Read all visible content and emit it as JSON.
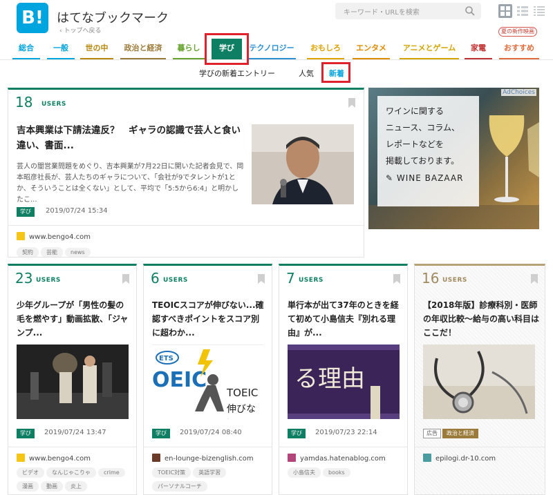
{
  "header": {
    "logo": "B!",
    "title": "はてなブックマーク",
    "back": "トップへ戻る",
    "search_placeholder": "キーワード・URLを検索",
    "promo_pill": "夏の新作映画"
  },
  "categories": [
    {
      "label": "総合",
      "color": "#00a4de"
    },
    {
      "label": "一般",
      "color": "#00a4de"
    },
    {
      "label": "世の中",
      "color": "#b8860b"
    },
    {
      "label": "政治と経済",
      "color": "#9b7b3a"
    },
    {
      "label": "暮らし",
      "color": "#65a32d"
    },
    {
      "label": "学び",
      "color": "#0e7f62"
    },
    {
      "label": "テクノロジー",
      "color": "#2a8fd6"
    },
    {
      "label": "おもしろ",
      "color": "#e0a300"
    },
    {
      "label": "エンタメ",
      "color": "#e08a00"
    },
    {
      "label": "アニメとゲーム",
      "color": "#d4a400"
    },
    {
      "label": "家電",
      "color": "#c03030"
    },
    {
      "label": "おすすめ",
      "color": "#e06a3a"
    }
  ],
  "subnav": {
    "title": "学びの新着エントリー",
    "popular": "人気",
    "new": "新着"
  },
  "users_label": "USERS",
  "entries": [
    {
      "users": "18",
      "title": "吉本興業は下請法違反？　ギャラの認識で芸人と食い違い、書面...",
      "excerpt": "芸人の闇営業問題をめぐり、吉本興業が7月22日に開いた記者会見で、岡本昭彦社長が、芸人たちのギャラについて、「会社が9でタレントが1とか、そういうことは全くない」として、平均で「5:5から6:4」と明かしたこ...",
      "badge": "学び",
      "date": "2019/07/24 15:34",
      "domain": "www.bengo4.com",
      "tags": [
        "契約",
        "芸能",
        "news"
      ]
    },
    {
      "users": "23",
      "title": "少年グループが「男性の髪の毛を燃やす」動画拡散、「ジャンプ...",
      "badge": "学び",
      "date": "2019/07/24 13:47",
      "domain": "www.bengo4.com",
      "tags": [
        "ビデオ",
        "なんじゃこりゃ",
        "crime",
        "漫画",
        "動画",
        "炎上"
      ]
    },
    {
      "users": "6",
      "title": "TEOICスコアが伸びない...確認すべきポイントをスコア別に超わか...",
      "thumb_text1": "TOEIC",
      "thumb_text2": "伸びない",
      "badge": "学び",
      "date": "2019/07/24 08:40",
      "domain": "en-lounge-bizenglish.com",
      "tags": [
        "TOEIC対策",
        "英語学習",
        "パーソナルコーチ"
      ]
    },
    {
      "users": "7",
      "title": "単行本が出て37年のときを経て初めて小島信夫『別れる理由』が...",
      "thumb_text": "る理由",
      "badge": "学び",
      "date": "2019/07/23 22:14",
      "domain": "yamdas.hatenablog.com",
      "tags": [
        "小島信夫",
        "books"
      ]
    },
    {
      "users": "16",
      "title": "【2018年版】診療科別・医師の年収比較〜給与の高い科目はここだ！",
      "badge_ad": "広告",
      "badge_cat": "政治と経済",
      "domain": "epilogi.dr-10.com"
    }
  ],
  "ad": {
    "adchoices": "AdChoices",
    "lines": [
      "ワインに関する",
      "ニュース、コラム、",
      "レポートなどを",
      "掲載しております。"
    ],
    "brand": "WINE BAZAAR"
  },
  "colors": {
    "manabi": "#0e7f62",
    "ad_card": "#b8a078",
    "highlight": "#e0212b",
    "link": "#00a4de"
  }
}
